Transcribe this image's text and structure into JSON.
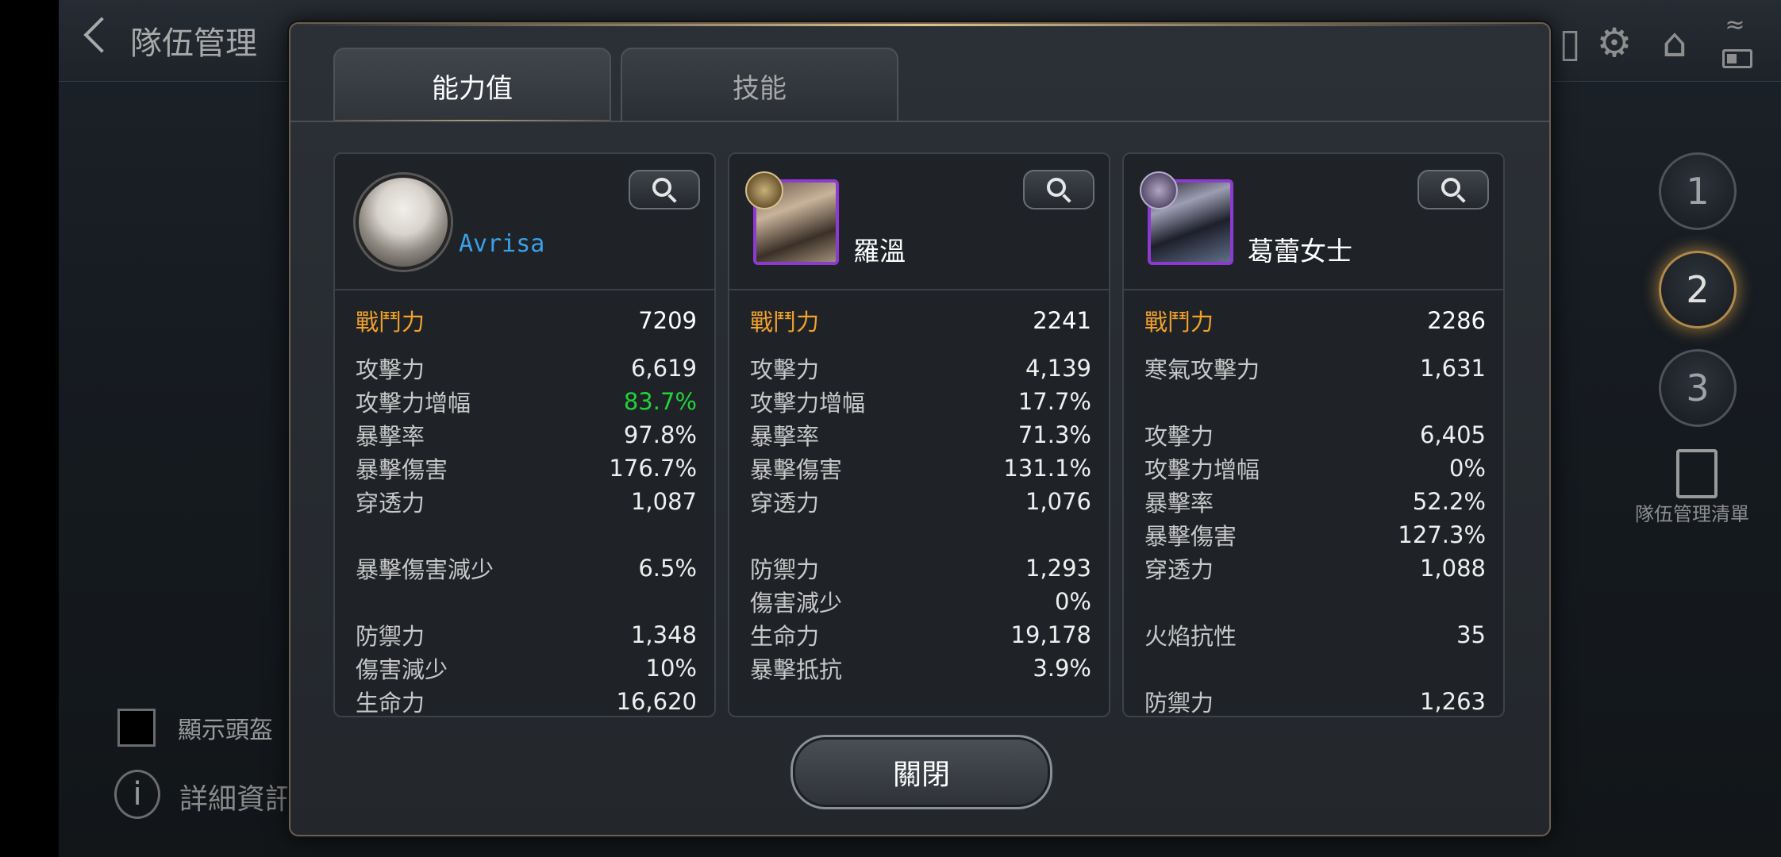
{
  "header": {
    "title": "隊伍管理"
  },
  "side": {
    "slots": [
      "1",
      "2",
      "3"
    ],
    "active_slot": "2",
    "team_list_label": "隊伍管理清單"
  },
  "bottom_left": {
    "show_helmet_label": "顯示頭盔",
    "details_label": "詳細資訊"
  },
  "dialog": {
    "tabs": [
      {
        "label": "能力值",
        "active": true
      },
      {
        "label": "技能",
        "active": false
      }
    ],
    "close_label": "關閉",
    "characters": [
      {
        "name": "Avrisa",
        "stats": [
          {
            "label": "戰鬥力",
            "value": "7209"
          },
          {
            "label": "攻擊力",
            "value": "6,619"
          },
          {
            "label": "攻擊力增幅",
            "value": "83.7%"
          },
          {
            "label": "暴擊率",
            "value": "97.8%"
          },
          {
            "label": "暴擊傷害",
            "value": "176.7%"
          },
          {
            "label": "穿透力",
            "value": "1,087"
          },
          {
            "label": "暴擊傷害減少",
            "value": "6.5%"
          },
          {
            "label": "防禦力",
            "value": "1,348"
          },
          {
            "label": "傷害減少",
            "value": "10%"
          },
          {
            "label": "生命力",
            "value": "16,620"
          }
        ]
      },
      {
        "name": "羅溫",
        "stats": [
          {
            "label": "戰鬥力",
            "value": "2241"
          },
          {
            "label": "攻擊力",
            "value": "4,139"
          },
          {
            "label": "攻擊力增幅",
            "value": "17.7%"
          },
          {
            "label": "暴擊率",
            "value": "71.3%"
          },
          {
            "label": "暴擊傷害",
            "value": "131.1%"
          },
          {
            "label": "穿透力",
            "value": "1,076"
          },
          {
            "label": "防禦力",
            "value": "1,293"
          },
          {
            "label": "傷害減少",
            "value": "0%"
          },
          {
            "label": "生命力",
            "value": "19,178"
          },
          {
            "label": "暴擊抵抗",
            "value": "3.9%"
          }
        ]
      },
      {
        "name": "葛蕾女士",
        "stats": [
          {
            "label": "戰鬥力",
            "value": "2286"
          },
          {
            "label": "寒氣攻擊力",
            "value": "1,631"
          },
          {
            "label": "攻擊力",
            "value": "6,405"
          },
          {
            "label": "攻擊力增幅",
            "value": "0%"
          },
          {
            "label": "暴擊率",
            "value": "52.2%"
          },
          {
            "label": "暴擊傷害",
            "value": "127.3%"
          },
          {
            "label": "穿透力",
            "value": "1,088"
          },
          {
            "label": "火焰抗性",
            "value": "35"
          },
          {
            "label": "防禦力",
            "value": "1,263"
          }
        ]
      }
    ]
  },
  "colors": {
    "power_label": "#f0a12a",
    "highlight_value": "#22d23a",
    "player_name": "#3aa0e8",
    "rare_frame": "#8d3ad0"
  }
}
